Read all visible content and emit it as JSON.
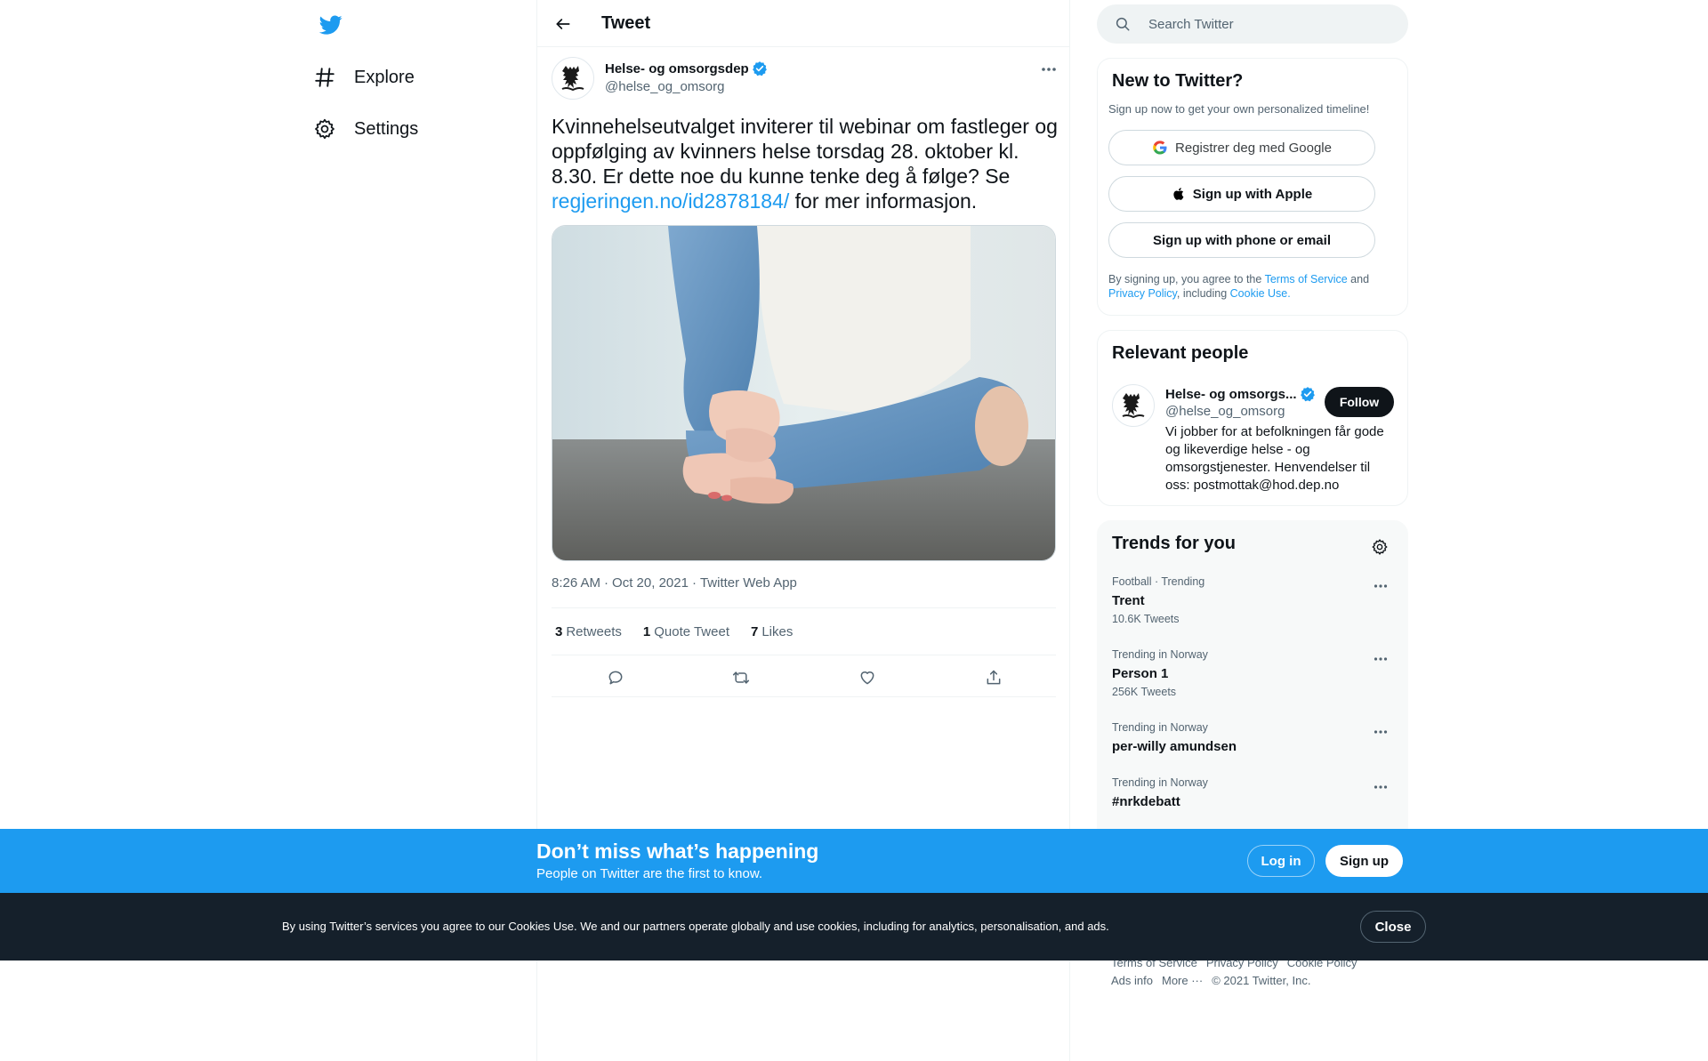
{
  "nav": {
    "logo": "twitter-bird",
    "items": [
      {
        "label": "Explore",
        "icon": "hashtag-icon"
      },
      {
        "label": "Settings",
        "icon": "gear-icon"
      }
    ]
  },
  "header": {
    "title": "Tweet"
  },
  "tweet": {
    "author_name": "Helse- og omsorgsdep",
    "handle": "@helse_og_omsorg",
    "verified": true,
    "text_before": "Kvinnehelseutvalget inviterer til webinar om fastleger og oppfølging av kvinners helse torsdag 28. oktober kl. 8.30. Er dette noe du kunne tenke deg å følge? Se ",
    "link": "regjeringen.no/id2878184/",
    "text_after": " for mer informasjon.",
    "time": "8:26 AM",
    "date": "Oct 20, 2021",
    "source": "Twitter Web App",
    "separator": "·",
    "stats": {
      "retweets_count": "3",
      "retweets_label": "Retweets",
      "quotes_count": "1",
      "quotes_label": "Quote Tweet",
      "likes_count": "7",
      "likes_label": "Likes"
    }
  },
  "search": {
    "placeholder": "Search Twitter"
  },
  "new_to_twitter": {
    "title": "New to Twitter?",
    "subtitle": "Sign up now to get your own personalized timeline!",
    "google_label": "Registrer deg med Google",
    "apple_label": "Sign up with Apple",
    "phone_label": "Sign up with phone or email",
    "terms_prefix": "By signing up, you agree to the ",
    "terms_link": "Terms of Service",
    "terms_and": " and ",
    "privacy_link": "Privacy Policy",
    "terms_including": ", including ",
    "cookie_link": "Cookie Use."
  },
  "relevant_people": {
    "title": "Relevant people",
    "name": "Helse- og omsorgs...",
    "handle": "@helse_og_omsorg",
    "follow_label": "Follow",
    "bio": "Vi jobber for at befolkningen får gode og likeverdige helse - og omsorgstjenester. Henvendelser til oss: postmottak@hod.dep.no"
  },
  "trends": {
    "title": "Trends for you",
    "items": [
      {
        "meta": "Football · Trending",
        "name": "Trent",
        "count": "10.6K Tweets"
      },
      {
        "meta": "Trending in Norway",
        "name": "Person 1",
        "count": "256K Tweets"
      },
      {
        "meta": "Trending in Norway",
        "name": "per-willy amundsen",
        "count": ""
      },
      {
        "meta": "Trending in Norway",
        "name": "#nrkdebatt",
        "count": ""
      }
    ]
  },
  "footer": {
    "links": [
      "Terms of Service",
      "Privacy Policy",
      "Cookie Policy",
      "Ads info",
      "More ···",
      "© 2021 Twitter, Inc."
    ]
  },
  "banner": {
    "title": "Don’t miss what’s happening",
    "subtitle": "People on Twitter are the first to know.",
    "login_label": "Log in",
    "signup_label": "Sign up"
  },
  "cookie_bar": {
    "text": "By using Twitter’s services you agree to our Cookies Use. We and our partners operate globally and use cookies, including for analytics, personalisation, and ads.",
    "close_label": "Close"
  },
  "colors": {
    "accent": "#1d9bf0",
    "text": "#0f1419",
    "muted": "#536471",
    "cookie_bg": "#15202b"
  }
}
